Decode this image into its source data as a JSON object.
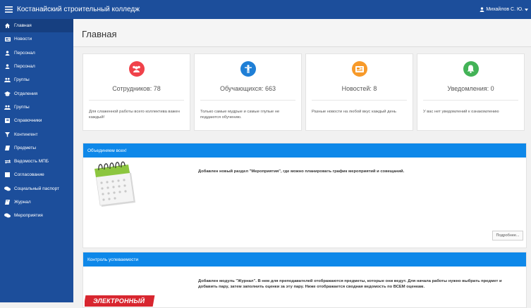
{
  "topbar": {
    "menu_icon": "hamburger-icon",
    "brand": "Костанайский строительный колледж",
    "user_name": "Михайлов С. Ю.",
    "user_icon": "user-icon",
    "caret_icon": "caret-down-icon"
  },
  "sidebar": {
    "items": [
      {
        "label": "Главная",
        "icon": "home-icon"
      },
      {
        "label": "Новости",
        "icon": "newspaper-icon"
      },
      {
        "label": "Персонал",
        "icon": "user-icon"
      },
      {
        "label": "Персонал",
        "icon": "user-icon"
      },
      {
        "label": "Группы",
        "icon": "users-icon"
      },
      {
        "label": "Отделения",
        "icon": "graduation-cap-icon"
      },
      {
        "label": "Группы",
        "icon": "users-icon"
      },
      {
        "label": "Справочники",
        "icon": "book-icon"
      },
      {
        "label": "Контингент",
        "icon": "filter-icon"
      },
      {
        "label": "Предметы",
        "icon": "book-open-icon"
      },
      {
        "label": "Ведомость МПБ",
        "icon": "exchange-icon"
      },
      {
        "label": "Согласование",
        "icon": "square-icon"
      },
      {
        "label": "Социальный паспорт",
        "icon": "comments-icon"
      },
      {
        "label": "Журнал",
        "icon": "journal-icon"
      },
      {
        "label": "Мероприятия",
        "icon": "comments-icon"
      }
    ]
  },
  "header": {
    "title": "Главная"
  },
  "cards": [
    {
      "icon": "users-icon",
      "color": "#f0424a",
      "title": "Сотрудников: 78",
      "desc": "Для слаженной работы всего коллектива важен каждый!"
    },
    {
      "icon": "child-icon",
      "color": "#1f7fd6",
      "title": "Обучающихся: 663",
      "desc": "Только самые мудрые и самые глупые не поддаются обучению."
    },
    {
      "icon": "newspaper-icon",
      "color": "#f79a2a",
      "title": "Новостей: 8",
      "desc": "Разные новости на любой вкус каждый день"
    },
    {
      "icon": "bell-icon",
      "color": "#43b357",
      "title": "Уведомления: 0",
      "desc": "У вас нет уведомлений к ознакомлению"
    }
  ],
  "panels": [
    {
      "heading": "Объединяем всех!",
      "text": "Добавлен новый раздел \"Мероприятия\", где можно планировать график мероприятий и совещаний.",
      "more_label": "Подробнее..."
    },
    {
      "heading": "Контроль успеваемости",
      "text": "Добавлен модуль \"Журнал\". В нем для преподавателей отображаются предметы, которые они ведут. Для начала работы нужно выбрать предмет и добавить пару, затем заполнить оценки за эту пару. Ниже отображается сводная ведомость по ВСЕМ оценкам.",
      "image_text": "ЭЛЕКТРОННЫЙ"
    }
  ]
}
